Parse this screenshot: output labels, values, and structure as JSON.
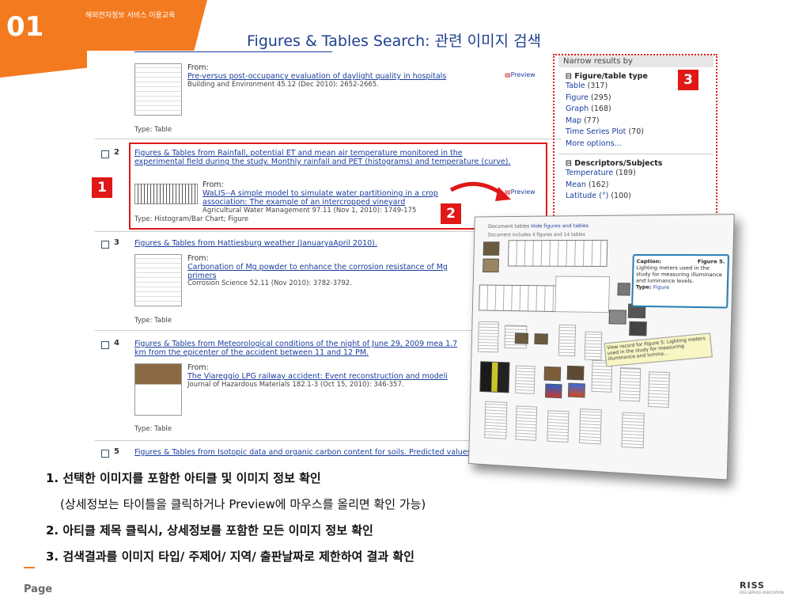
{
  "header": {
    "number": "01",
    "small_label": "해외전자정보 서비스 이용교육",
    "title": "Figures & Tables Search: 관련 이미지 검색"
  },
  "results": [
    {
      "number": "",
      "title": "",
      "from_label": "From:",
      "article": "Pre-versus post-occupancy evaluation of daylight quality in hospitals",
      "source": "Building and Environment 45.12 (Dec 2010): 2652-2665.",
      "type": "Type: Table",
      "preview": "Preview"
    },
    {
      "number": "2",
      "title": "Figures & Tables from Rainfall, potential ET and mean air temperature monitored in the experimental field during the study. Monthly rainfall and PET (histograms) and temperature (curve).",
      "from_label": "From:",
      "article": "WaLIS--A simple model to simulate water partitioning in a crop association: The example of an intercropped vineyard",
      "source": "Agricultural Water Management 97.11 (Nov 1, 2010): 1749-175",
      "type": "Type: Histogram/Bar Chart; Figure",
      "preview": "Preview"
    },
    {
      "number": "3",
      "title": "Figures & Tables from Hattiesburg weather (JanuaryaApril 2010).",
      "from_label": "From:",
      "article": "Carbonation of Mg powder to enhance the corrosion resistance of Mg primers",
      "source": "Corrosion Science 52.11 (Nov 2010): 3782-3792.",
      "type": "Type: Table"
    },
    {
      "number": "4",
      "title": "Figures & Tables from Meteorological conditions of the night of June 29, 2009 mea 1.7 km from the epicenter of the accident between 11 and 12 PM.",
      "from_label": "From:",
      "article": "The Viareggio LPG railway accident: Event reconstruction and modeli",
      "source": "Journal of Hazardous Materials 182.1-3 (Oct 15, 2010): 346-357.",
      "type": "Type: Table"
    },
    {
      "number": "5",
      "title": "Figures & Tables from Isotopic data and organic carbon content for soils. Predicted values"
    }
  ],
  "facets": {
    "head": "Narrow results by",
    "group1": "Figure/table type",
    "group1_items": [
      {
        "label": "Table",
        "count": "(317)"
      },
      {
        "label": "Figure",
        "count": "(295)"
      },
      {
        "label": "Graph",
        "count": "(168)"
      },
      {
        "label": "Map",
        "count": "(77)"
      },
      {
        "label": "Time Series Plot",
        "count": "(70)"
      }
    ],
    "more": "More options...",
    "group2": "Descriptors/Subjects",
    "group2_items": [
      {
        "label": "Temperature",
        "count": "(189)"
      },
      {
        "label": "Mean",
        "count": "(162)"
      },
      {
        "label": "Latitude (°)",
        "count": "(100)"
      }
    ]
  },
  "badges": {
    "b1": "1",
    "b2": "2",
    "b3": "3"
  },
  "popout": {
    "tab_label": "Document tables",
    "tab_link": "Hide figures and tables",
    "subtitle": "Document includes 4 figures and 14 tables",
    "caption_head": "Caption:",
    "caption_fig": "Figure 5.",
    "caption_text": "Lighting meters used in the study for measuring illuminance and luminance levels.",
    "caption_type_label": "Type:",
    "caption_type": "Figure",
    "tooltip": "View record for Figure 5: Lighting meters used in the study for measuring illuminance and lumina..."
  },
  "notes": [
    "1. 선택한 이미지를 포함한 아티클 및 이미지 정보 확인",
    "(상세정보는 타이틀을 클릭하거나 Preview에 마우스를 올리면 확인 가능)",
    "2. 아티클 제목 클릭시, 상세정보를 포함한 모든 이미지 정보 확인",
    "3. 검색결과를 이미지 타입/ 주제어/ 지역/ 출판날짜로 제한하여 결과 확인"
  ],
  "footer": {
    "page_label": "Page",
    "logo": "RISS",
    "logo_sub": "RISS SERVICE ASSOCIATION"
  },
  "colors": {
    "accent": "#f47a1f",
    "highlight": "#e01818",
    "link": "#1a3e9e"
  }
}
